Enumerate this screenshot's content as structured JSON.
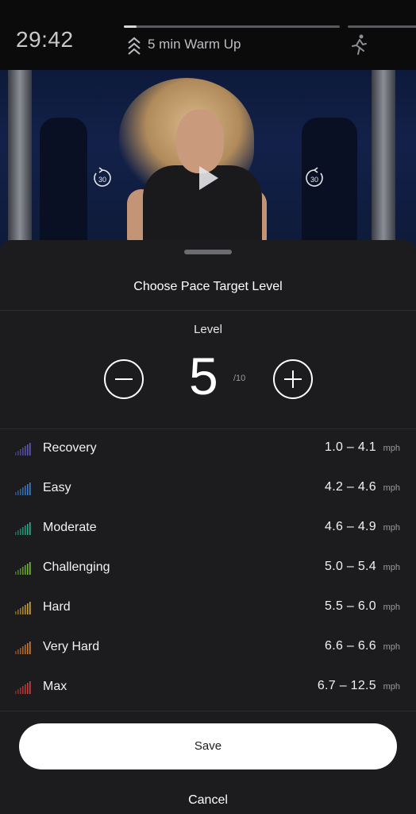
{
  "header": {
    "timer": "29:42",
    "segment_label": "5 min Warm Up",
    "segment_progress": 0.06
  },
  "video": {
    "rewind_label": "30",
    "forward_label": "30"
  },
  "sheet": {
    "title": "Choose Pace Target Level",
    "level_label": "Level",
    "level_value": "5",
    "level_max": "/10",
    "zones": [
      {
        "name": "Recovery",
        "range": "1.0 – 4.1",
        "unit": "mph",
        "color": "#6b5fd6"
      },
      {
        "name": "Easy",
        "range": "4.2 – 4.6",
        "unit": "mph",
        "color": "#3a8ef0"
      },
      {
        "name": "Moderate",
        "range": "4.6 – 4.9",
        "unit": "mph",
        "color": "#1fc79a"
      },
      {
        "name": "Challenging",
        "range": "5.0 – 5.4",
        "unit": "mph",
        "color": "#7bd32a"
      },
      {
        "name": "Hard",
        "range": "5.5 – 6.0",
        "unit": "mph",
        "color": "#f0b82a"
      },
      {
        "name": "Very Hard",
        "range": "6.6 – 6.6",
        "unit": "mph",
        "color": "#f0862a"
      },
      {
        "name": "Max",
        "range": "6.7 – 12.5",
        "unit": "mph",
        "color": "#f0403a"
      }
    ],
    "save_label": "Save",
    "cancel_label": "Cancel"
  }
}
